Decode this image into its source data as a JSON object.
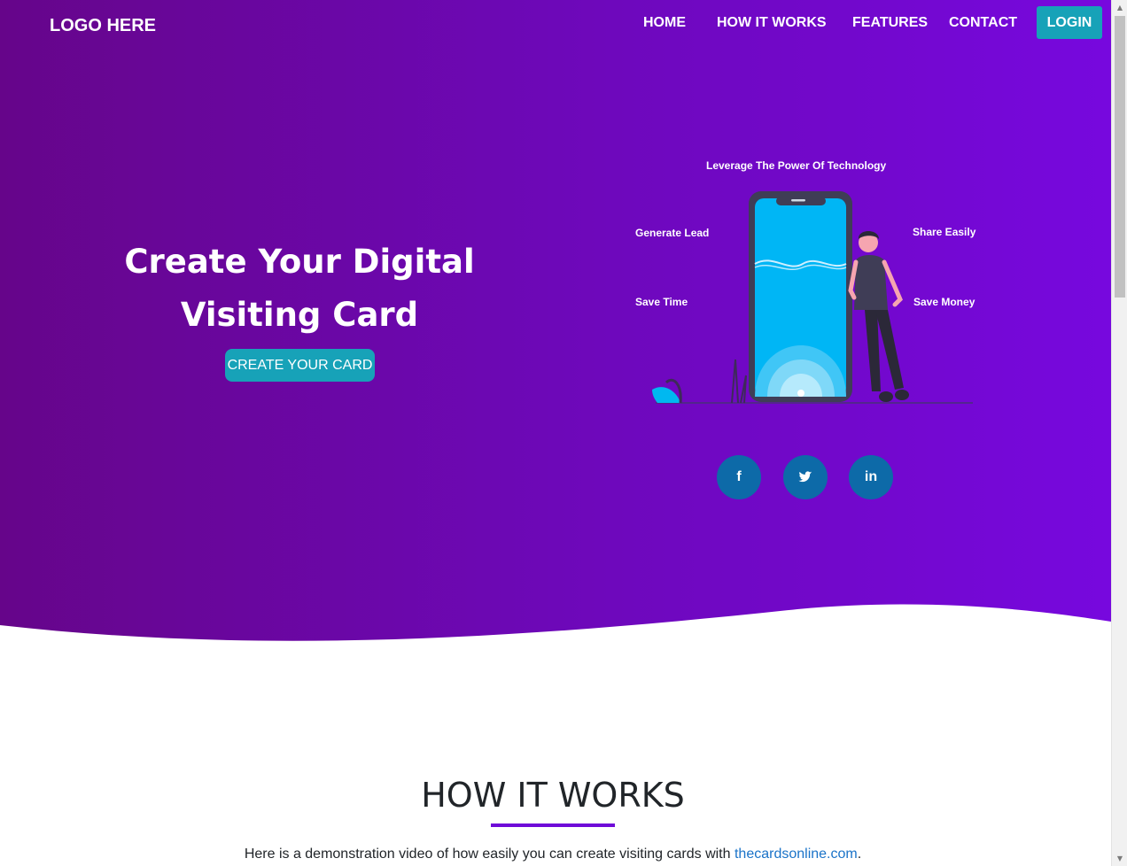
{
  "nav": {
    "logo": "LOGO HERE",
    "links": [
      "HOME",
      "HOW IT WORKS",
      "FEATURES",
      "CONTACT"
    ],
    "login": "LOGIN"
  },
  "hero": {
    "title": "Create Your Digital Visiting Card",
    "cta": "CREATE YOUR CARD",
    "illustration": {
      "top_label": "Leverage The Power Of Technology",
      "left_top": "Generate Lead",
      "left_bottom": "Save Time",
      "right_top": "Share Easily",
      "right_bottom": "Save Money"
    },
    "social": [
      {
        "icon": "facebook-icon",
        "glyph": "f"
      },
      {
        "icon": "twitter-icon",
        "glyph": "🐦"
      },
      {
        "icon": "linkedin-icon",
        "glyph": "in"
      }
    ]
  },
  "how_it_works": {
    "title": "HOW IT WORKS",
    "text_before": "Here is a demonstration video of how easily you can create visiting cards with ",
    "link": "thecardsonline.com",
    "text_after": "."
  },
  "colors": {
    "gradient_start": "#66058a",
    "gradient_end": "#7708de",
    "button": "#17a2b8",
    "social": "#0d6aa8",
    "underline": "#6f0ad8"
  }
}
